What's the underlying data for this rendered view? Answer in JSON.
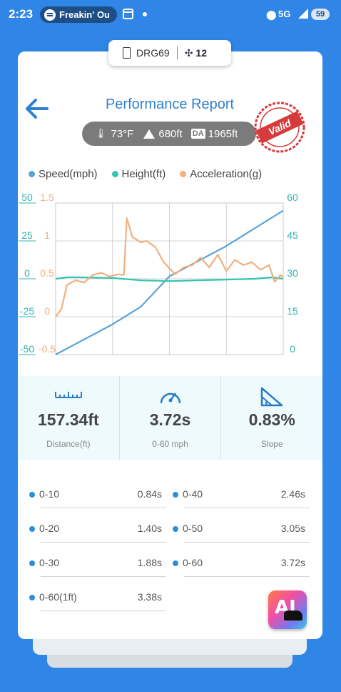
{
  "status_bar": {
    "time": "2:23",
    "media_text": "Freakin' Ou",
    "network": "5G",
    "battery": "59"
  },
  "device": {
    "name": "DRG69",
    "satellites": "12"
  },
  "header": {
    "title": "Performance Report",
    "temperature": "73°F",
    "altitude": "680ft",
    "da_badge": "DA",
    "density_altitude": "1965ft",
    "stamp_text": "Valid"
  },
  "chart_data": {
    "type": "line",
    "x_range": [
      0,
      4
    ],
    "series": [
      {
        "name": "Speed(mph)",
        "axis": "right",
        "color": "#5aa3d6",
        "points": [
          [
            0,
            0
          ],
          [
            0.5,
            6
          ],
          [
            1,
            12
          ],
          [
            1.5,
            19
          ],
          [
            2,
            31
          ],
          [
            2.5,
            37
          ],
          [
            3,
            43
          ],
          [
            3.5,
            50
          ],
          [
            4,
            57
          ]
        ]
      },
      {
        "name": "Height(ft)",
        "axis": "left",
        "color": "#33c4b4",
        "points": [
          [
            0,
            0
          ],
          [
            0.2,
            1
          ],
          [
            0.4,
            1
          ],
          [
            1,
            0.5
          ],
          [
            1.5,
            -1
          ],
          [
            2,
            -1.5
          ],
          [
            2.5,
            -1
          ],
          [
            3,
            -0.5
          ],
          [
            3.5,
            0
          ],
          [
            3.8,
            1
          ],
          [
            4,
            0
          ]
        ]
      },
      {
        "name": "Acceleration(g)",
        "axis": "left2",
        "color": "#f0b07f",
        "points": [
          [
            0,
            0
          ],
          [
            0.1,
            0.1
          ],
          [
            0.2,
            0.42
          ],
          [
            0.35,
            0.48
          ],
          [
            0.5,
            0.45
          ],
          [
            0.65,
            0.55
          ],
          [
            0.8,
            0.58
          ],
          [
            0.95,
            0.53
          ],
          [
            1.1,
            0.56
          ],
          [
            1.2,
            0.55
          ],
          [
            1.25,
            1.3
          ],
          [
            1.35,
            1.05
          ],
          [
            1.5,
            0.98
          ],
          [
            1.6,
            1.0
          ],
          [
            1.75,
            0.92
          ],
          [
            1.9,
            0.72
          ],
          [
            2.1,
            0.56
          ],
          [
            2.25,
            0.65
          ],
          [
            2.4,
            0.68
          ],
          [
            2.55,
            0.78
          ],
          [
            2.7,
            0.65
          ],
          [
            2.85,
            0.82
          ],
          [
            3.0,
            0.6
          ],
          [
            3.15,
            0.75
          ],
          [
            3.3,
            0.68
          ],
          [
            3.45,
            0.72
          ],
          [
            3.6,
            0.62
          ],
          [
            3.75,
            0.68
          ],
          [
            3.85,
            0.46
          ],
          [
            3.95,
            0.55
          ],
          [
            4,
            0.52
          ]
        ]
      }
    ],
    "left_axis_ticks": [
      "50",
      "25",
      "0",
      "-25",
      "-50"
    ],
    "left_axis2_ticks": [
      "1.5",
      "1",
      "0.5",
      "0",
      "-0.5"
    ],
    "right_axis_ticks": [
      "60",
      "45",
      "30",
      "15",
      "0"
    ],
    "left_axis_range": [
      -50,
      50
    ],
    "left_axis2_range": [
      -0.5,
      1.5
    ],
    "right_axis_range": [
      0,
      60
    ],
    "grid": true,
    "legend_position": "top",
    "axis_colors": {
      "left": "#33b3b3",
      "left2": "#f0b07f",
      "right": "#33b3b3"
    }
  },
  "metrics": [
    {
      "value": "157.34ft",
      "label": "Distance(ft)",
      "icon": "ruler-icon"
    },
    {
      "value": "3.72s",
      "label": "0-60 mph",
      "icon": "speedometer-icon"
    },
    {
      "value": "0.83%",
      "label": "Slope",
      "icon": "slope-icon"
    }
  ],
  "splits": [
    {
      "label": "0-10",
      "value": "0.84s"
    },
    {
      "label": "0-40",
      "value": "2.46s"
    },
    {
      "label": "0-20",
      "value": "1.40s"
    },
    {
      "label": "0-50",
      "value": "3.05s"
    },
    {
      "label": "0-30",
      "value": "1.88s"
    },
    {
      "label": "0-60",
      "value": "3.72s"
    },
    {
      "label": "0-60(1ft)",
      "value": "3.38s"
    }
  ],
  "ai_button": {
    "label": "AI"
  }
}
